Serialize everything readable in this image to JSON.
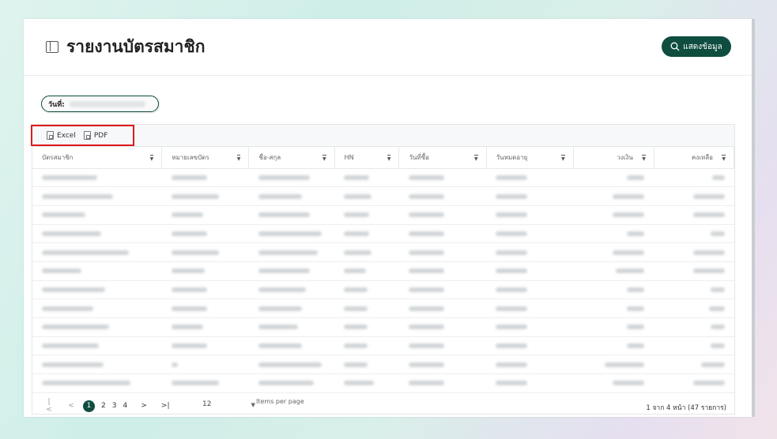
{
  "header": {
    "title": "รายงานบัตรสมาชิก",
    "show_button_label": "แสดงข้อมูล"
  },
  "filter": {
    "date_label": "วันที่:"
  },
  "toolbar": {
    "excel_label": "Excel",
    "pdf_label": "PDF"
  },
  "table": {
    "columns": [
      {
        "label": "บัตรสมาชิก",
        "align": "left"
      },
      {
        "label": "หมายเลขบัตร",
        "align": "left"
      },
      {
        "label": "ชื่อ-สกุล",
        "align": "left"
      },
      {
        "label": "HN",
        "align": "left"
      },
      {
        "label": "วันที่ซื้อ",
        "align": "left"
      },
      {
        "label": "วันหมดอายุ",
        "align": "left"
      },
      {
        "label": "วงเงิน",
        "align": "right"
      },
      {
        "label": "คงเหลือ",
        "align": "right"
      }
    ],
    "row_count": 12
  },
  "pager": {
    "pages": [
      "1",
      "2",
      "3",
      "4"
    ],
    "active_page": "1",
    "first": "|<",
    "prev": "<",
    "next": ">",
    "last": ">|",
    "per_page_value": "12",
    "per_page_arrow": "▼",
    "per_page_label": "Items per page",
    "info": "1 จาก 4 หน้า (47 รายการ)"
  },
  "colors": {
    "brand": "#0e4d3f",
    "export_highlight": "#e0191c"
  }
}
